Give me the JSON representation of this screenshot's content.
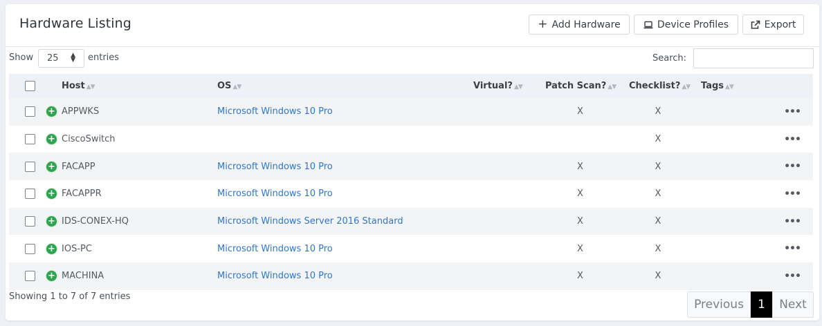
{
  "header": {
    "title": "Hardware Listing",
    "buttons": [
      {
        "label": "Add Hardware",
        "icon": "plus-icon"
      },
      {
        "label": "Device Profiles",
        "icon": "laptop-icon"
      },
      {
        "label": "Export",
        "icon": "external-link-icon"
      }
    ]
  },
  "controls": {
    "show_label": "Show",
    "page_length": "25",
    "entries_label": "entries",
    "search_label": "Search:",
    "search_value": ""
  },
  "table": {
    "columns": [
      "Host",
      "OS",
      "Virtual?",
      "Patch Scan?",
      "Checklist?",
      "Tags"
    ],
    "rows": [
      {
        "host": "APPWKS",
        "os": "Microsoft Windows 10 Pro",
        "virtual": "",
        "patch": "X",
        "checklist": "X",
        "tags": ""
      },
      {
        "host": "CiscoSwitch",
        "os": "",
        "virtual": "",
        "patch": "",
        "checklist": "X",
        "tags": ""
      },
      {
        "host": "FACAPP",
        "os": "Microsoft Windows 10 Pro",
        "virtual": "",
        "patch": "X",
        "checklist": "X",
        "tags": ""
      },
      {
        "host": "FACAPPR",
        "os": "Microsoft Windows 10 Pro",
        "virtual": "",
        "patch": "X",
        "checklist": "X",
        "tags": ""
      },
      {
        "host": "IDS-CONEX-HQ",
        "os": "Microsoft Windows Server 2016 Standard",
        "virtual": "",
        "patch": "X",
        "checklist": "X",
        "tags": ""
      },
      {
        "host": "IOS-PC",
        "os": "Microsoft Windows 10 Pro",
        "virtual": "",
        "patch": "X",
        "checklist": "X",
        "tags": ""
      },
      {
        "host": "MACHINA",
        "os": "Microsoft Windows 10 Pro",
        "virtual": "",
        "patch": "X",
        "checklist": "X",
        "tags": ""
      }
    ],
    "row_action": "•••",
    "expand_icon": "+"
  },
  "footer": {
    "info": "Showing 1 to 7 of 7 entries",
    "previous_label": "Previous",
    "current_page": "1",
    "next_label": "Next"
  },
  "colors": {
    "link": "#2f76c9",
    "expand_green": "#2ea44f",
    "header_row_bg": "#eef1f7",
    "current_page_bg": "#000000"
  }
}
